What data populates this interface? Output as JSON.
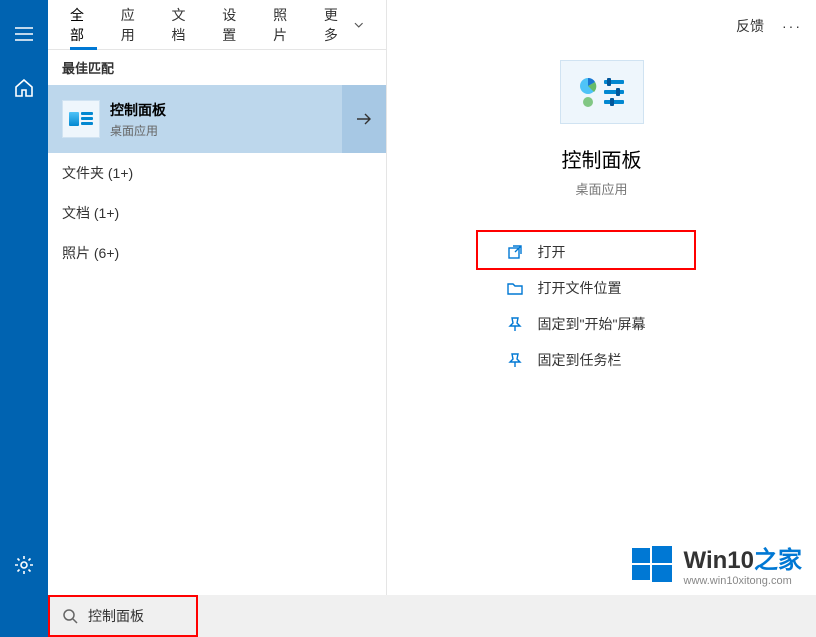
{
  "rail": {
    "menu": "menu",
    "home": "home",
    "settings": "settings"
  },
  "tabs": {
    "items": [
      "全部",
      "应用",
      "文档",
      "设置",
      "照片"
    ],
    "more": "更多",
    "active_index": 0
  },
  "topRight": {
    "feedback": "反馈"
  },
  "section": {
    "best_match": "最佳匹配"
  },
  "result": {
    "title": "控制面板",
    "subtitle": "桌面应用"
  },
  "categories": [
    "文件夹 (1+)",
    "文档 (1+)",
    "照片 (6+)"
  ],
  "detail": {
    "title": "控制面板",
    "subtitle": "桌面应用"
  },
  "actions": {
    "open": "打开",
    "open_location": "打开文件位置",
    "pin_start": "固定到\"开始\"屏幕",
    "pin_taskbar": "固定到任务栏"
  },
  "search": {
    "query": "控制面板"
  },
  "branding": {
    "title_a": "Win10",
    "title_b": "之家",
    "url": "www.win10xitong.com"
  }
}
